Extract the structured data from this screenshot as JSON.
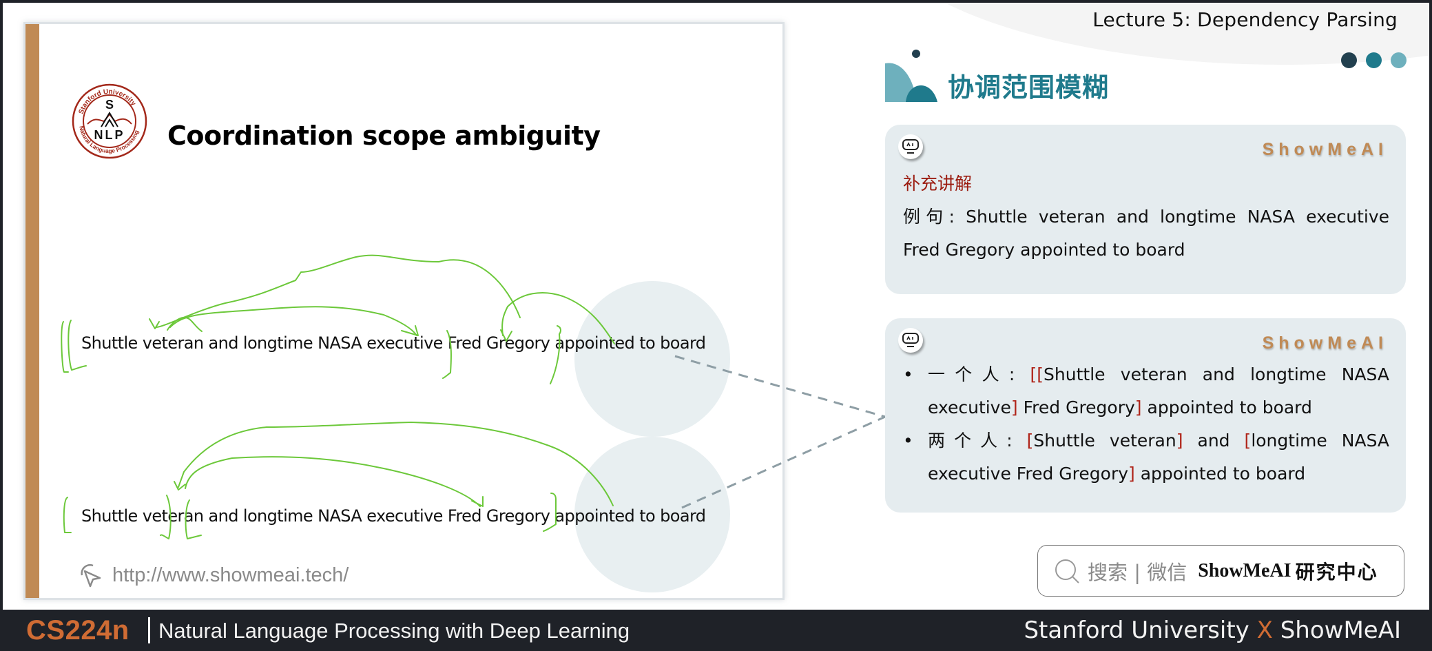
{
  "header": {
    "lecture_title": "Lecture 5:  Dependency Parsing",
    "section_title": "协调范围模糊",
    "dot_colors": [
      "#22404f",
      "#1f7a8c",
      "#6eb0bd"
    ]
  },
  "slide": {
    "logo": {
      "top_text": "Stanford University",
      "bottom_text": "Natural Language Processing",
      "letters_top": "S",
      "letters_bottom": "NLP"
    },
    "title": "Coordination scope ambiguity",
    "sentence_1": "Shuttle veteran and longtime NASA executive Fred Gregory appointed to board",
    "sentence_2": "Shuttle veteran and longtime NASA executive Fred Gregory appointed to board",
    "url": "http://www.showmeai.tech/",
    "accent_bar_color": "#c08a55",
    "annotation_color": "#6cc83a"
  },
  "cards": [
    {
      "brand": "ShowMeAI",
      "label": "补充讲解",
      "text_line1": "例句: Shuttle veteran and longtime NASA executive",
      "text_line2": "Fred Gregory appointed to board"
    },
    {
      "brand": "ShowMeAI",
      "items": [
        {
          "prefix": "一个人: ",
          "row1": [
            {
              "t": "[[",
              "br": true
            },
            {
              "t": "Shuttle veteran and longtime NASA",
              "br": false
            }
          ],
          "row2": [
            {
              "t": "executive",
              "br": false
            },
            {
              "t": "]",
              "br": true
            },
            {
              "t": " Fred Gregory",
              "br": false
            },
            {
              "t": "]",
              "br": true
            },
            {
              "t": " appointed to board",
              "br": false
            }
          ]
        },
        {
          "prefix": "两个人: ",
          "row1": [
            {
              "t": "[",
              "br": true
            },
            {
              "t": "Shuttle veteran",
              "br": false
            },
            {
              "t": "]",
              "br": true
            },
            {
              "t": " and ",
              "br": false
            },
            {
              "t": "[",
              "br": true
            },
            {
              "t": "longtime NASA",
              "br": false
            }
          ],
          "row2": [
            {
              "t": "executive Fred Gregory",
              "br": false
            },
            {
              "t": "]",
              "br": true
            },
            {
              "t": " appointed to board",
              "br": false
            }
          ]
        }
      ]
    }
  ],
  "search": {
    "hint": "搜索 | 微信",
    "brand": "ShowMeAI",
    "brand_cn": "研究中心"
  },
  "footer": {
    "course_code": "CS224n",
    "course_name": "Natural Language Processing with Deep Learning",
    "right_left": "Stanford University",
    "right_x": "X",
    "right_right": "ShowMeAI"
  }
}
